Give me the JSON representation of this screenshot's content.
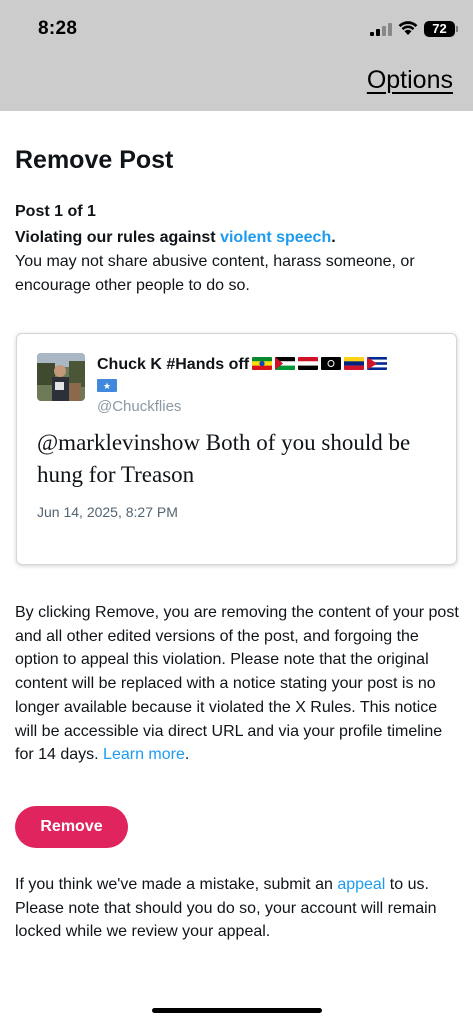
{
  "status_bar": {
    "time": "8:28",
    "battery": "72"
  },
  "header": {
    "options_label": "Options"
  },
  "page": {
    "title": "Remove Post",
    "post_count": "Post 1 of 1",
    "rule_prefix": "Violating our rules against ",
    "rule_link": "violent speech",
    "rule_suffix": ".",
    "rule_description": "You may not share abusive content, harass someone, or encourage other people to do so."
  },
  "post": {
    "author_name": "Chuck K #Hands off",
    "flags": [
      "ethiopia-flag",
      "palestine-flag",
      "yemen-flag",
      "afghanistan-flag",
      "venezuela-flag",
      "cuba-flag",
      "somalia-flag"
    ],
    "handle": "@Chuckflies",
    "text": "@marklevinshow Both of you should be hung for Treason",
    "timestamp": "Jun 14, 2025, 8:27 PM"
  },
  "explanation": {
    "text": "By clicking Remove, you are removing the content of your post and all other edited versions of the post, and forgoing the option to appeal this violation. Please note that the original content will be replaced with a notice stating your post is no longer available because it violated the X Rules. This notice will be accessible via direct URL and via your profile timeline for 14 days. ",
    "learn_more": "Learn more",
    "suffix": "."
  },
  "remove_button": {
    "label": "Remove"
  },
  "footer": {
    "prefix": "If you think we've made a mistake, submit an ",
    "appeal_link": "appeal",
    "suffix": " to us. Please note that should you do so, your account will remain locked while we review your appeal."
  },
  "colors": {
    "link": "#1d9bf0",
    "remove_button": "#e0245e",
    "header_bg": "#cccccc",
    "muted": "#536471"
  }
}
